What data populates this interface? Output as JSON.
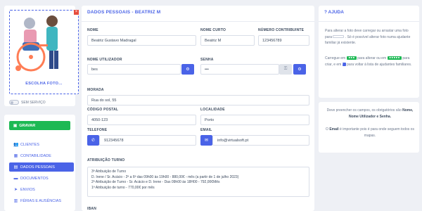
{
  "photo": {
    "label": "ESCOLHA FOTO...",
    "toggle_label": "SEM SERVIÇO"
  },
  "actions": {
    "save_label": "GRAVAR"
  },
  "menu": {
    "items": [
      {
        "label": "CLIENTES",
        "icon": "users-icon",
        "active": false
      },
      {
        "label": "CONTABILIDADE",
        "icon": "calculator-icon",
        "active": false
      },
      {
        "label": "DADOS PESSOAIS",
        "icon": "id-card-icon",
        "active": true
      },
      {
        "label": "DOCUMENTOS",
        "icon": "folder-icon",
        "active": false
      },
      {
        "label": "ENVIOS",
        "icon": "send-icon",
        "active": false
      },
      {
        "label": "FÉRIAS E AUSÊNCIAS",
        "icon": "calendar-icon",
        "active": false
      }
    ]
  },
  "form": {
    "title": "DADOS PESSOAIS - BEATRIZ M",
    "nome": {
      "label": "NOME",
      "value": "Beatriz Gustavo Madragal"
    },
    "nome_curto": {
      "label": "NOME CURTO",
      "value": "Beatriz M"
    },
    "contribuinte": {
      "label": "NÚMERO CONTRIBUINTE",
      "value": "123456789"
    },
    "utilizador": {
      "label": "NOME UTILIZADOR",
      "value": "bes"
    },
    "senha": {
      "label": "SENHA",
      "value": "•••"
    },
    "morada": {
      "label": "MORADA",
      "value": "Rua do sol, 55"
    },
    "codigo_postal": {
      "label": "CÓDIGO POSTAL",
      "value": "4050-123"
    },
    "localidade": {
      "label": "LOCALIDADE",
      "value": "Porto"
    },
    "telefone": {
      "label": "TELEFONE",
      "value": "912345678"
    },
    "email": {
      "label": "EMAIL",
      "value": "info@virtualsoft.pt"
    },
    "atribuicao": {
      "label": "ATRIBUIÇÃO TURNO",
      "lines": [
        "3ª Atribuição de Turno",
        "D. Irene / Sr. Acácio - 2ª a 6ª das 09h00 às 19h00 - 880,00€ - mês (a partir de 1 de julho 2023)",
        "2ª Atribuição de Turno - Sr. Acácio e D. Irene - Das 09h00 às 18H00 - 792,00€Mês",
        "1ª Atribuição de turno  -  770,00€ por mês"
      ]
    },
    "iban": {
      "label": "IBAN"
    }
  },
  "help": {
    "title": "? AJUDA",
    "p1_a": "Para alterar a foto deve carregar ou arrastar uma foto para",
    "p1_b": ". Só é possível alterar foto numa ajudante familiar já existente.",
    "p2_a": "Carregue em",
    "p2_b": "para alterar ou em",
    "p2_c": "para criar, e em",
    "p2_d": "para voltar à lista de ajudantes familiares."
  },
  "requirements": {
    "p1_a": "Deve preencher os campos, os obrigatórios são",
    "p1_b": "Nome, Nome Utilizador e Senha.",
    "p2_a": "O",
    "p2_b": "Email",
    "p2_c": "é importante pois é para onde seguem todos os mapas."
  },
  "colors": {
    "accent": "#4a63e7",
    "success": "#1db954",
    "background": "#eef0f5"
  }
}
